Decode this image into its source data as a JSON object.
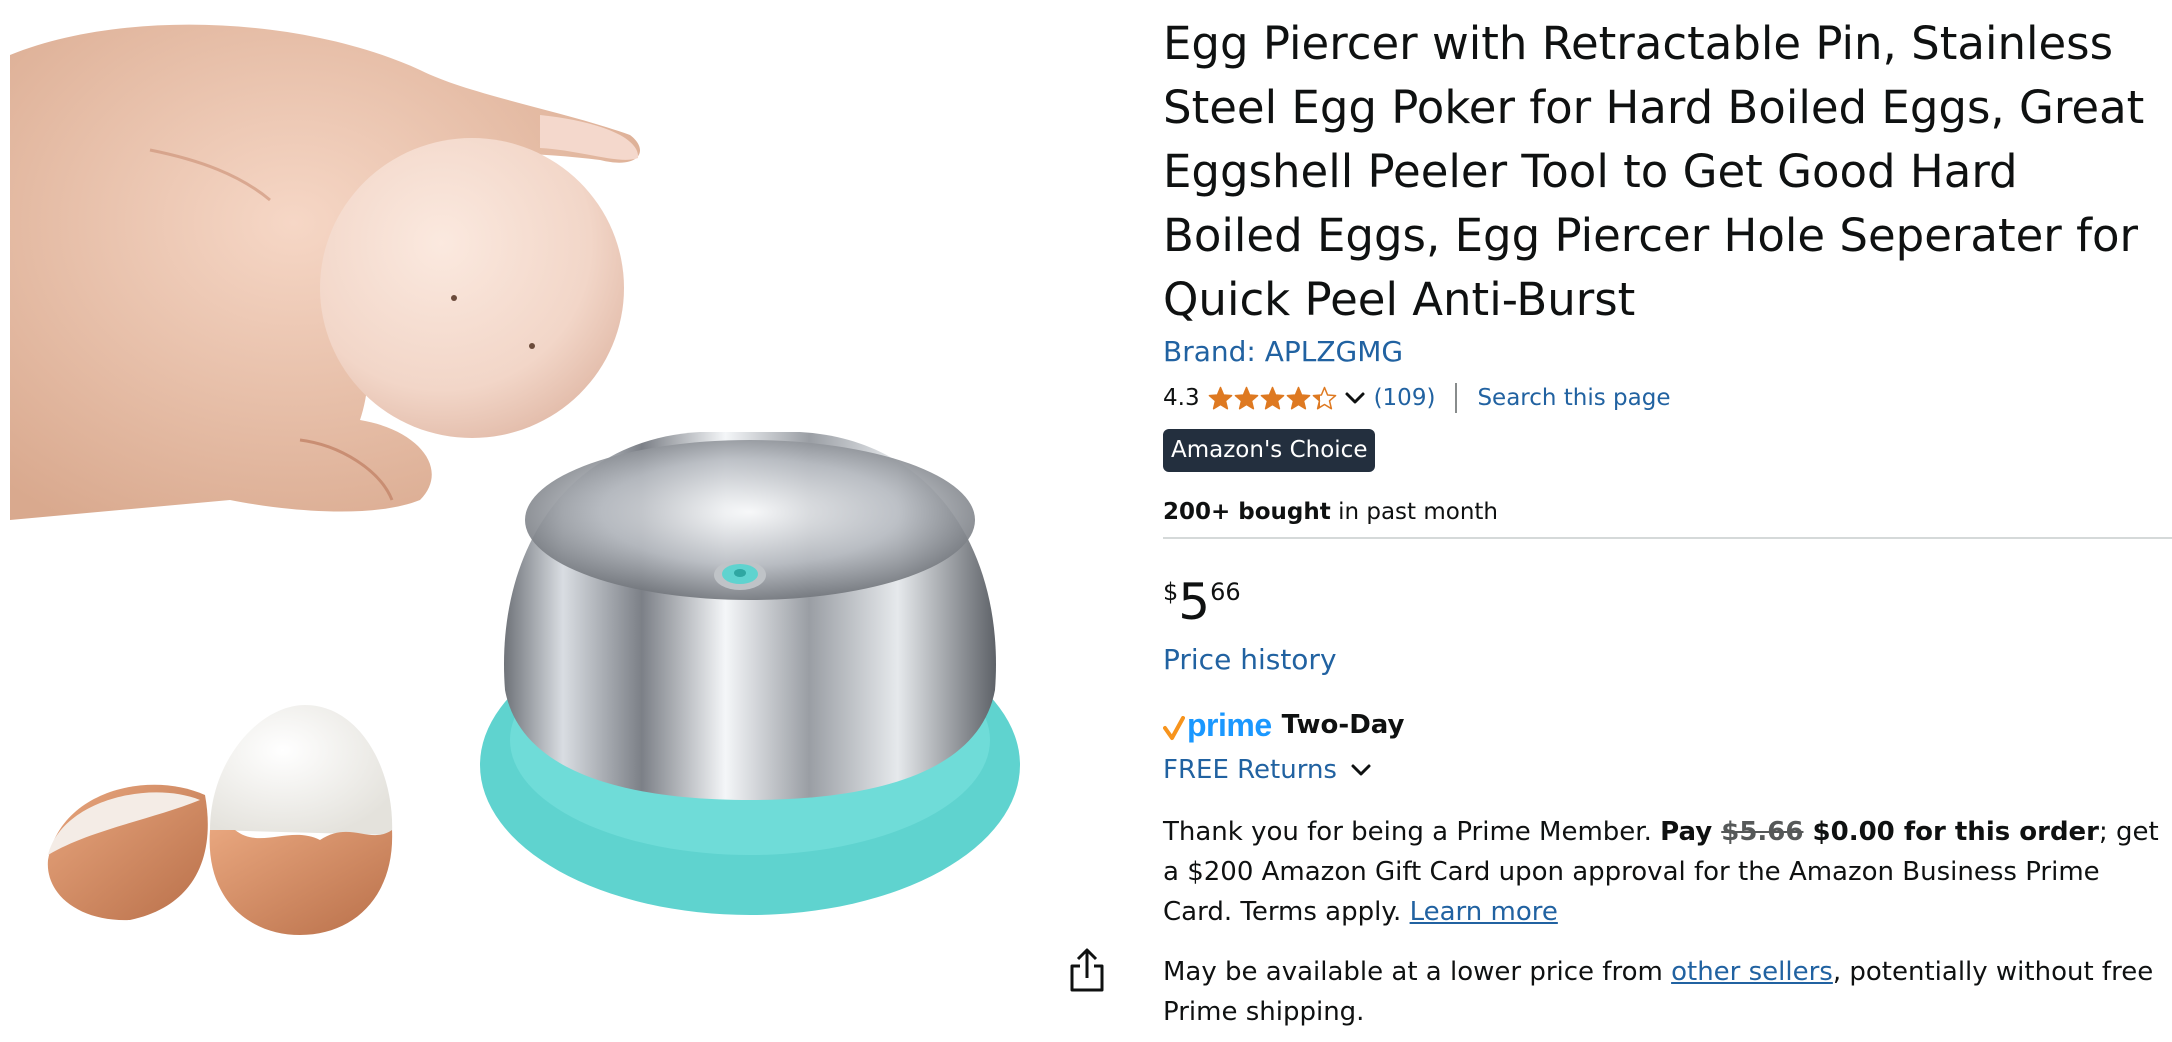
{
  "product": {
    "title": "Egg Piercer with Retractable Pin, Stainless Steel Egg Poker for Hard Boiled Eggs, Great Eggshell Peeler Tool to Get Good Hard Boiled Eggs, Egg Piercer Hole Seperater for Quick Peel Anti-Burst",
    "brand_label": "Brand: APLZGMG",
    "rating_value": "4.3",
    "rating_stars": 4.3,
    "review_count": "(109)",
    "search_link": "Search this page",
    "badge": "Amazon's Choice",
    "bought_bold": "200+ bought",
    "bought_rest": " in past month"
  },
  "price": {
    "symbol": "$",
    "whole": "5",
    "fraction": "66",
    "history_link": "Price history"
  },
  "delivery": {
    "prime_label": "prime",
    "prime_speed": "Two-Day",
    "free_returns": "FREE Returns"
  },
  "prime_card": {
    "text1": "Thank you for being a Prime Member. ",
    "pay_bold": "Pay ",
    "strike_price": "$5.66",
    "bold_rest": " $0.00 for this order",
    "text2": "; get a $200 Amazon Gift Card upon approval for the Amazon Business Prime Card. Terms apply. ",
    "learn_more": "Learn more"
  },
  "other_sellers": {
    "text1": "May be available at a lower price from ",
    "link": "other sellers",
    "text2": ", potentially without free Prime shipping."
  },
  "colors": {
    "link": "#2162a1",
    "star": "#de7921",
    "badge_bg": "#232f3e",
    "prime_blue": "#1a98ff",
    "prime_check": "#f7941d",
    "teal": "#5fd3cf"
  },
  "icons": {
    "share": "share-icon",
    "chevron": "chevron-down-icon",
    "star": "star-icon",
    "prime_check": "prime-check-icon"
  }
}
